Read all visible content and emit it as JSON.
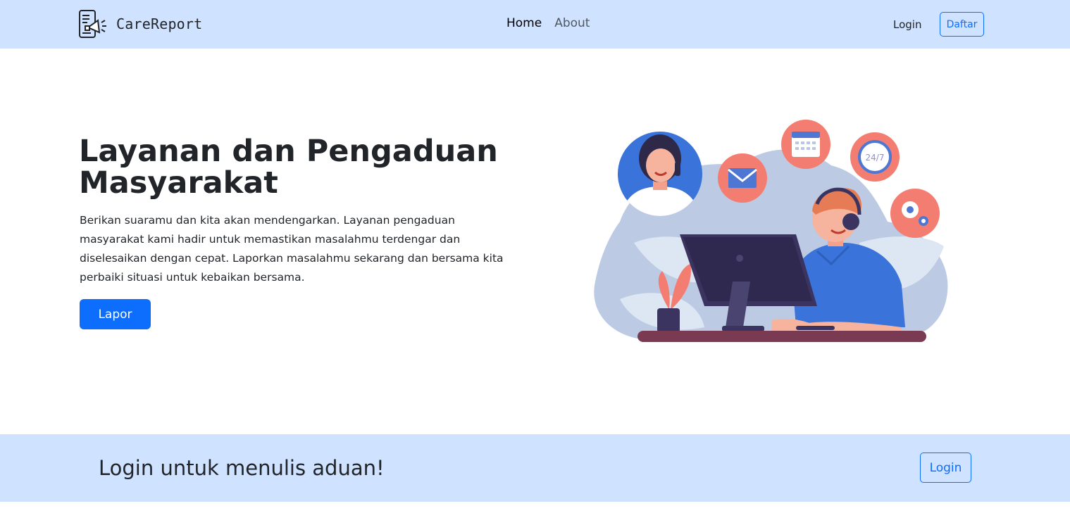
{
  "navbar": {
    "brand": {
      "name": "CareReport",
      "icon": "megaphone-report-icon"
    },
    "links": [
      {
        "label": "Home",
        "active": true
      },
      {
        "label": "About",
        "active": false
      }
    ],
    "login_label": "Login",
    "register_label": "Daftar"
  },
  "hero": {
    "title": "Layanan dan Pengaduan Masyarakat",
    "description": "Berikan suaramu dan kita akan mendengarkan. Layanan pengaduan masyarakat kami hadir untuk memastikan masalahmu terdengar dan diselesaikan dengan cepat. Laporkan masalahmu sekarang dan bersama kita perbaiki situasi untuk kebaikan bersama.",
    "cta_label": "Lapor",
    "illustration": {
      "description_icon": "customer-service-illustration",
      "badge_clock_text": "24/7"
    }
  },
  "cta_band": {
    "title": "Login untuk menulis aduan!",
    "button_label": "Login"
  },
  "colors": {
    "primary": "#0d6efd",
    "band_bg": "#cfe2ff",
    "text": "#212529",
    "coral": "#f47d71",
    "navy": "#3b3461",
    "blob": "#bccbe3"
  }
}
